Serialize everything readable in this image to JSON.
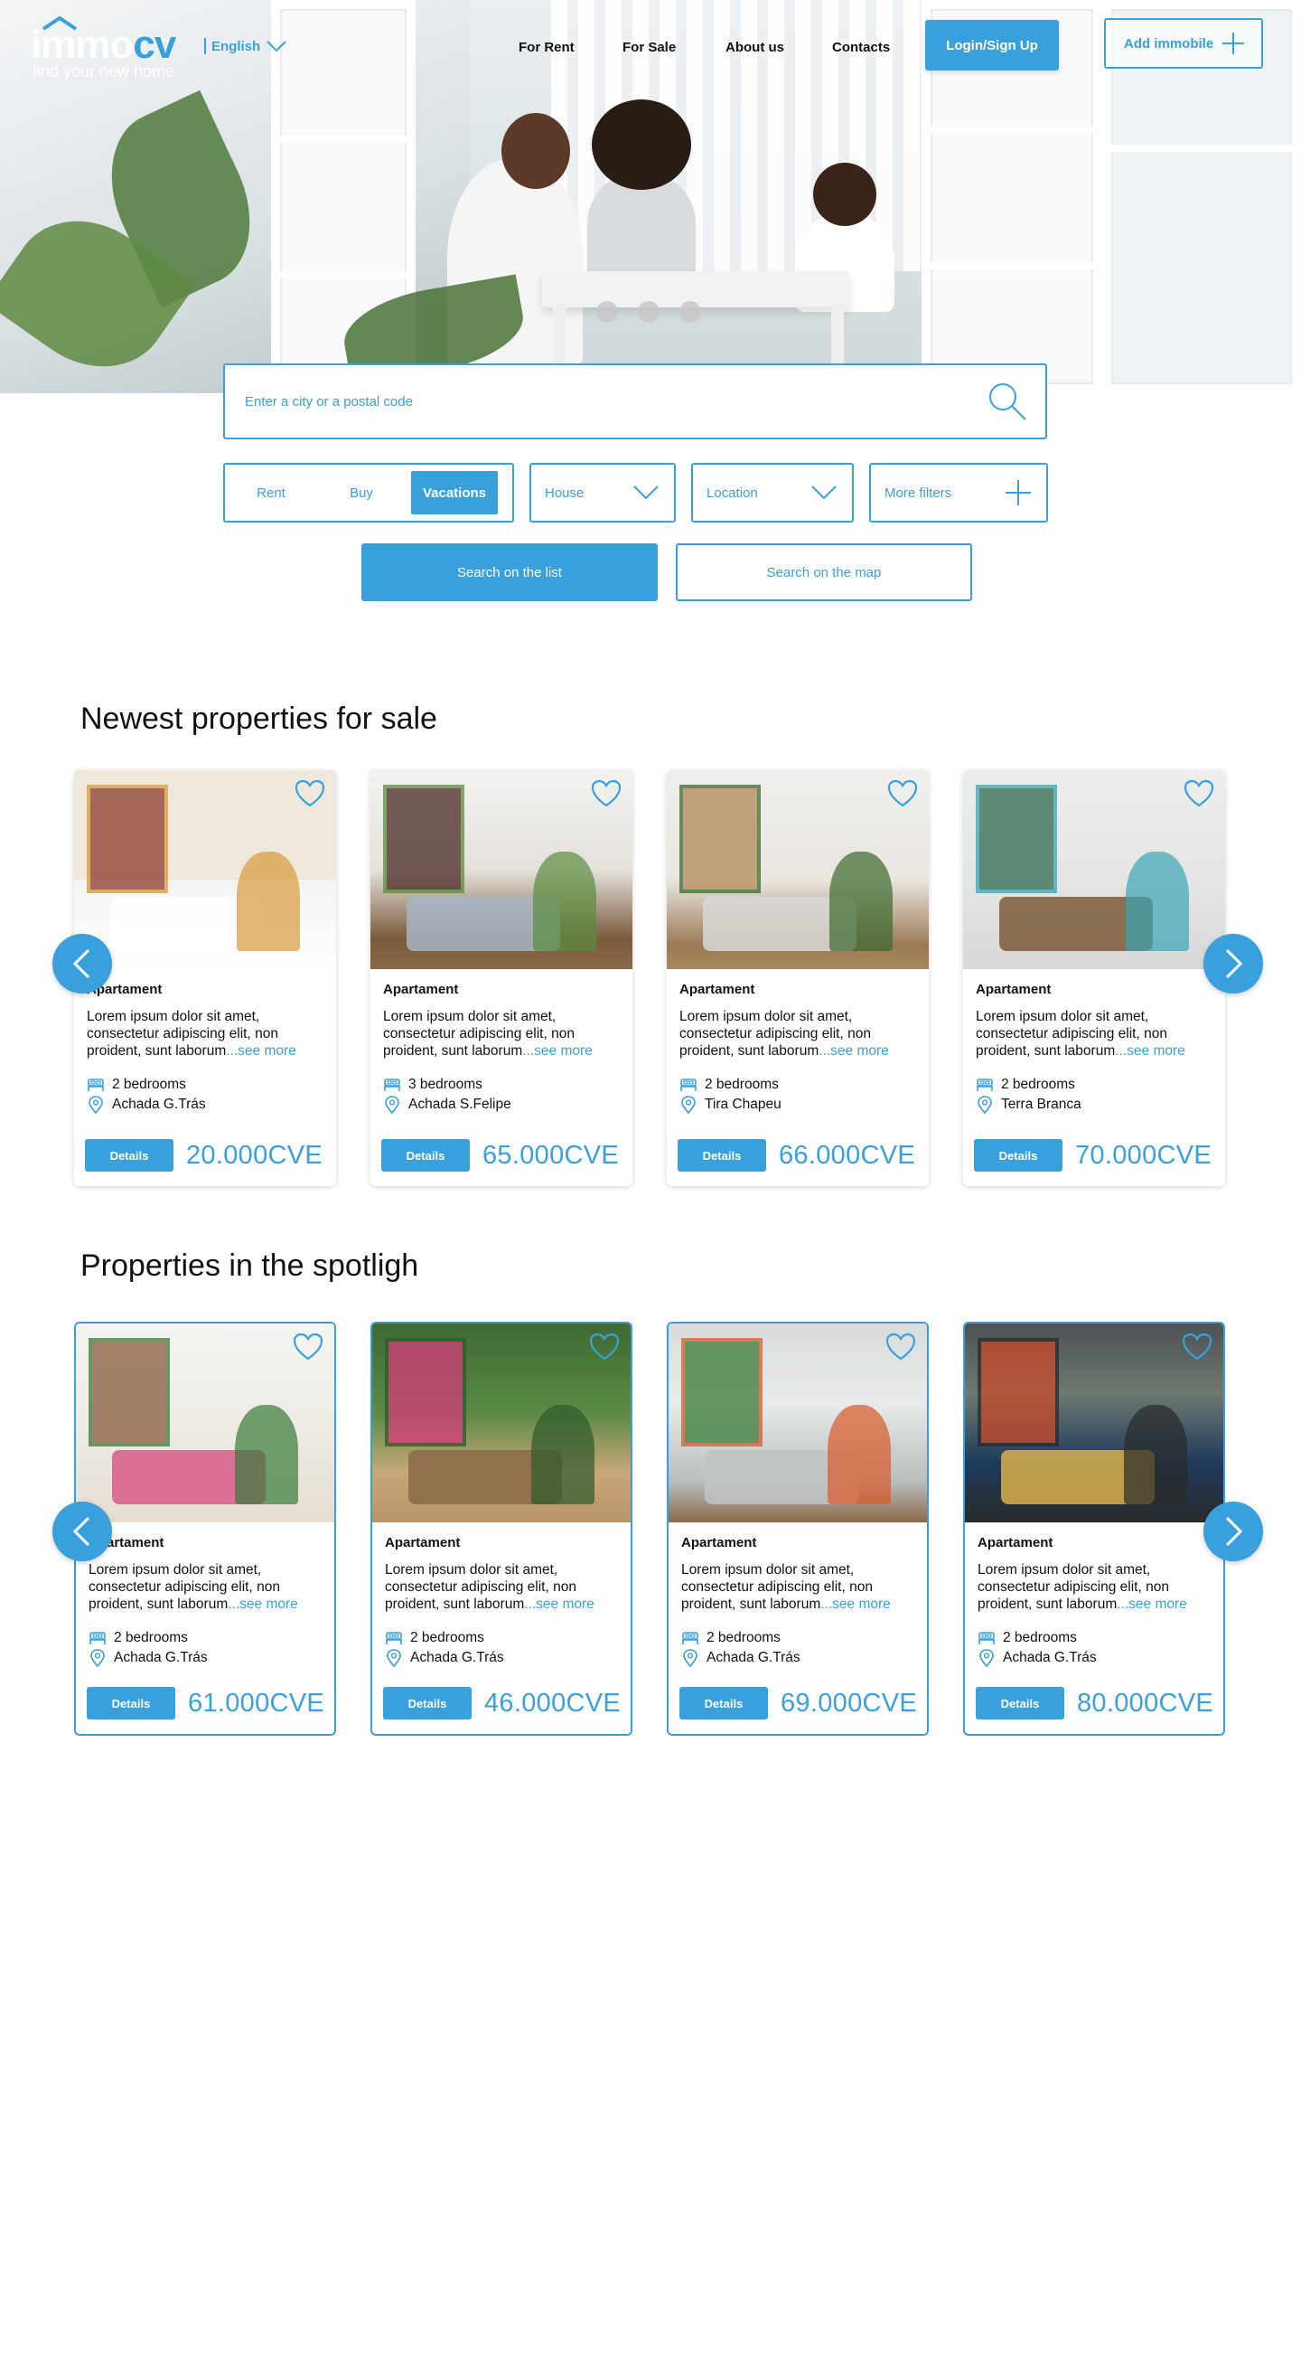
{
  "brand": {
    "logo_white": "immo",
    "logo_blue": "cv",
    "tagline": "find your new home",
    "accent": "#3aa0db"
  },
  "header": {
    "language": "English",
    "nav": [
      "For Rent",
      "For Sale",
      "About us",
      "Contacts"
    ],
    "login_label": "Login/Sign Up",
    "add_label": "Add immobile"
  },
  "search": {
    "placeholder": "Enter a city or a postal code",
    "modes": [
      "Rent",
      "Buy",
      "Vacations"
    ],
    "selected_mode": "Vacations",
    "type_select": "House",
    "location_select": "Location",
    "more_filters": "More filters",
    "list_button": "Search on the list",
    "map_button": "Search on the map"
  },
  "newest": {
    "title": "Newest properties for sale",
    "cards": [
      {
        "type": "Apartament",
        "desc": "Lorem ipsum dolor sit amet, consectetur adipiscing elit,  non proident, sunt laborum",
        "more": "...see more",
        "bedrooms": "2 bedrooms",
        "location": "Achada G.Trás",
        "details": "Details",
        "price": "20.000CVE"
      },
      {
        "type": "Apartament",
        "desc": "Lorem ipsum dolor sit amet, consectetur adipiscing elit,  non proident, sunt laborum",
        "more": "...see more",
        "bedrooms": "3 bedrooms",
        "location": "Achada S.Felipe",
        "details": "Details",
        "price": "65.000CVE"
      },
      {
        "type": "Apartament",
        "desc": "Lorem ipsum dolor sit amet, consectetur adipiscing elit,  non proident, sunt laborum",
        "more": "...see more",
        "bedrooms": "2 bedrooms",
        "location": "Tira Chapeu",
        "details": "Details",
        "price": "66.000CVE"
      },
      {
        "type": "Apartament",
        "desc": "Lorem ipsum dolor sit amet, consectetur adipiscing elit,  non proident, sunt laborum",
        "more": "...see more",
        "bedrooms": "2 bedrooms",
        "location": "Terra Branca",
        "details": "Details",
        "price": "70.000CVE"
      }
    ]
  },
  "spotlight": {
    "title": "Properties in the spotligh",
    "cards": [
      {
        "type": "Apartament",
        "desc": "Lorem ipsum dolor sit amet, consectetur adipiscing elit,  non proident, sunt laborum",
        "more": "...see more",
        "bedrooms": "2 bedrooms",
        "location": "Achada G.Trás",
        "details": "Details",
        "price": "61.000CVE"
      },
      {
        "type": "Apartament",
        "desc": "Lorem ipsum dolor sit amet, consectetur adipiscing elit,  non proident, sunt laborum",
        "more": "...see more",
        "bedrooms": "2 bedrooms",
        "location": "Achada G.Trás",
        "details": "Details",
        "price": "46.000CVE"
      },
      {
        "type": "Apartament",
        "desc": "Lorem ipsum dolor sit amet, consectetur adipiscing elit,  non proident, sunt laborum",
        "more": "...see more",
        "bedrooms": "2 bedrooms",
        "location": "Achada G.Trás",
        "details": "Details",
        "price": "69.000CVE"
      },
      {
        "type": "Apartament",
        "desc": "Lorem ipsum dolor sit amet, consectetur adipiscing elit,  non proident, sunt laborum",
        "more": "...see more",
        "bedrooms": "2 bedrooms",
        "location": "Achada G.Trás",
        "details": "Details",
        "price": "80.000CVE"
      }
    ]
  }
}
